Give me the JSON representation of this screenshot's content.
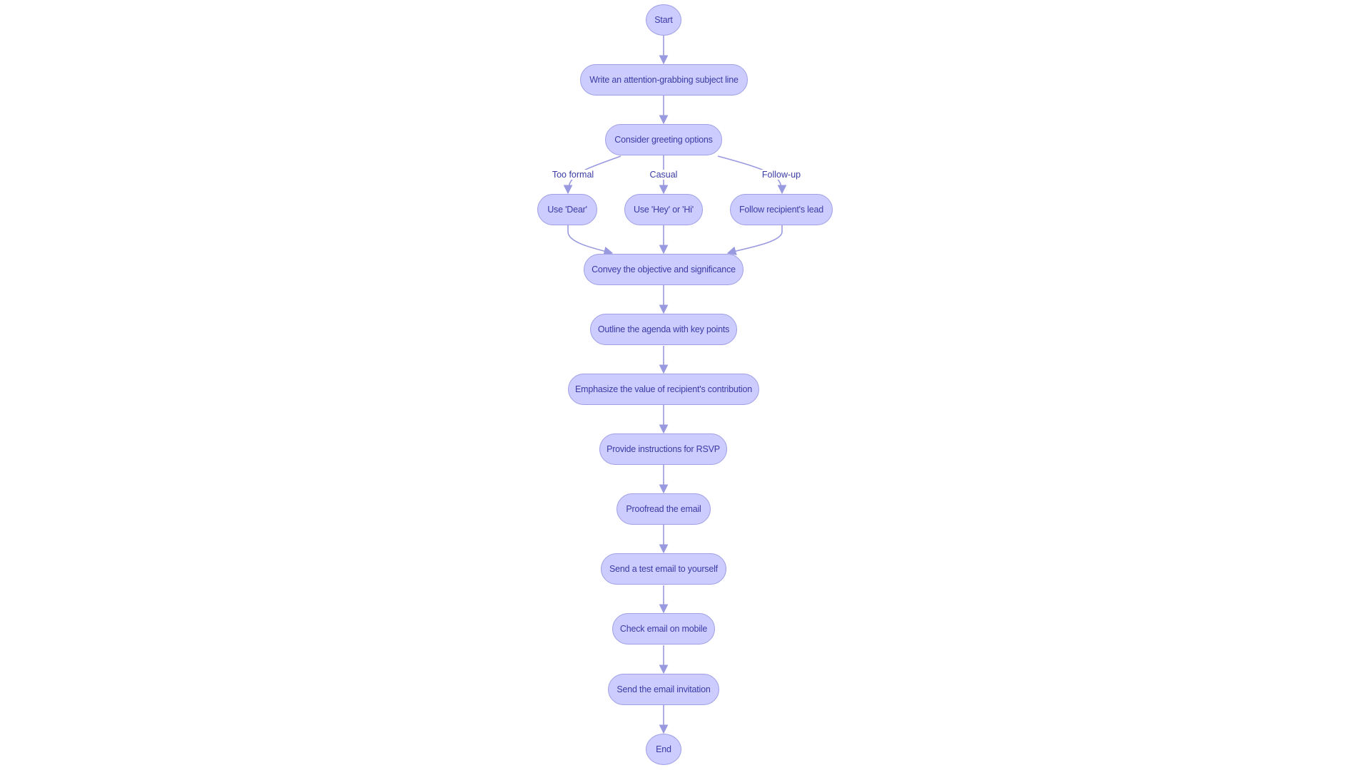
{
  "diagram": {
    "type": "flowchart",
    "direction": "top-down",
    "colors": {
      "node_fill": "#ccccff",
      "node_border": "#9f9fe6",
      "text": "#3b3ba6",
      "edge": "#9999e0"
    },
    "nodes": {
      "start": "Start",
      "subject": "Write an attention-grabbing subject line",
      "greeting": "Consider greeting options",
      "dear": "Use 'Dear'",
      "hey": "Use 'Hey' or 'Hi'",
      "follow": "Follow recipient's lead",
      "convey": "Convey the objective and significance",
      "agenda": "Outline the agenda with key points",
      "emphasize": "Emphasize the value of recipient's contribution",
      "rsvp": "Provide instructions for RSVP",
      "proofread": "Proofread the email",
      "test": "Send a test email to yourself",
      "mobile": "Check email on mobile",
      "send": "Send the email invitation",
      "end": "End"
    },
    "edges": [
      {
        "from": "start",
        "to": "subject",
        "label": ""
      },
      {
        "from": "subject",
        "to": "greeting",
        "label": ""
      },
      {
        "from": "greeting",
        "to": "dear",
        "label": "Too formal"
      },
      {
        "from": "greeting",
        "to": "hey",
        "label": "Casual"
      },
      {
        "from": "greeting",
        "to": "follow",
        "label": "Follow-up"
      },
      {
        "from": "dear",
        "to": "convey",
        "label": ""
      },
      {
        "from": "hey",
        "to": "convey",
        "label": ""
      },
      {
        "from": "follow",
        "to": "convey",
        "label": ""
      },
      {
        "from": "convey",
        "to": "agenda",
        "label": ""
      },
      {
        "from": "agenda",
        "to": "emphasize",
        "label": ""
      },
      {
        "from": "emphasize",
        "to": "rsvp",
        "label": ""
      },
      {
        "from": "rsvp",
        "to": "proofread",
        "label": ""
      },
      {
        "from": "proofread",
        "to": "test",
        "label": ""
      },
      {
        "from": "test",
        "to": "mobile",
        "label": ""
      },
      {
        "from": "mobile",
        "to": "send",
        "label": ""
      },
      {
        "from": "send",
        "to": "end",
        "label": ""
      }
    ],
    "edge_labels": {
      "too_formal": "Too formal",
      "casual": "Casual",
      "follow_up": "Follow-up"
    }
  }
}
